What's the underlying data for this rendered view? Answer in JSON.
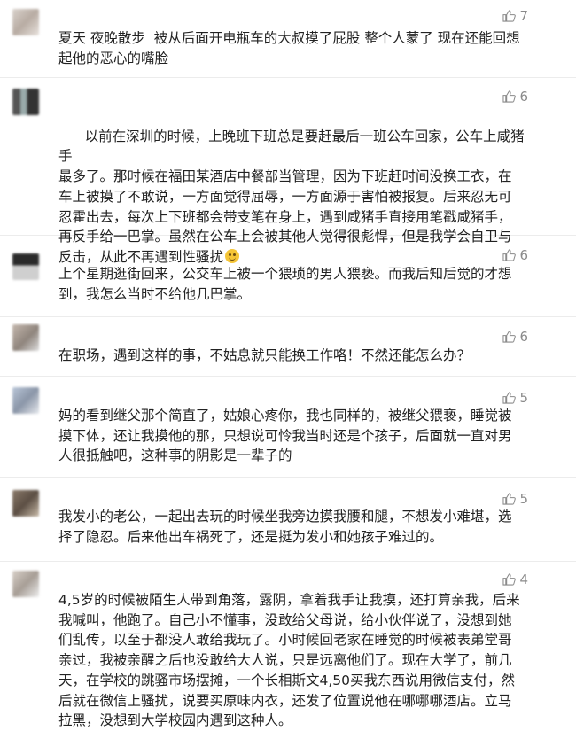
{
  "comments": [
    {
      "likes": "7",
      "text": "夏天 夜晚散步  被从后面开电瓶车的大叔摸了屁股 整个人蒙了 现在还能回想\n起他的恶心的嘴脸"
    },
    {
      "likes": "6",
      "text": "以前在深圳的时候，上晚班下班总是要赶最后一班公车回家，公车上咸猪手\n最多了。那时候在福田某酒店中餐部当管理，因为下班赶时间没换工衣，在\n车上被摸了不敢说，一方面觉得屈辱，一方面源于害怕被报复。后来忍无可\n忍霍出去，每次上下班都会带支笔在身上，遇到咸猪手直接用笔戳咸猪手，\n再反手给一巴掌。虽然在公车上会被其他人觉得很彪悍，但是我学会自卫与\n反击，从此不再遇到性骚扰"
    },
    {
      "likes": "6",
      "text": "上个星期逛街回来，公交车上被一个猥琐的男人猥亵。而我后知后觉的才想\n到，我怎么当时不给他几巴掌。"
    },
    {
      "likes": "6",
      "text": "在职场，遇到这样的事，不姑息就只能换工作咯！不然还能怎么办？"
    },
    {
      "likes": "5",
      "text": "妈的看到继父那个简直了，姑娘心疼你，我也同样的，被继父猥亵，睡觉被\n摸下体，还让我摸他的那，只想说可怜我当时还是个孩子，后面就一直对男\n人很抵触吧，这种事的阴影是一辈子的"
    },
    {
      "likes": "5",
      "text": "我发小的老公，一起出去玩的时候坐我旁边摸我腰和腿，不想发小难堪，选\n择了隐忍。后来他出车祸死了，还是挺为发小和她孩子难过的。"
    },
    {
      "likes": "4",
      "text": "4,5岁的时候被陌生人带到角落，露阴，拿着我手让我摸，还打算亲我，后来\n我喊叫，他跑了。自己小不懂事，没敢给父母说，给小伙伴说了，没想到她\n们乱传，以至于都没人敢给我玩了。小时候回老家在睡觉的时候被表弟堂哥\n亲过，我被亲醒之后也没敢给大人说，只是远离他们了。现在大学了，前几\n天，在学校的跳骚市场摆摊，一个长相斯文4,50买我东西说用微信支付，然\n后就在微信上骚扰，说要买原味内衣，还发了位置说他在哪哪哪酒店。立马\n拉黑，没想到大学校园内遇到这种人。"
    }
  ],
  "icons": {
    "like": "thumbs-up-icon",
    "emoji": "smiling-face-icon"
  },
  "colors": {
    "like": "#8a8a8a",
    "text": "#222222",
    "divider": "#ececec"
  }
}
